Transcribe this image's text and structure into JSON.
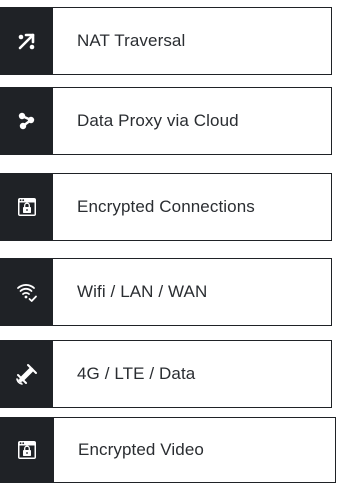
{
  "features": [
    {
      "label": "NAT Traversal",
      "icon": "nat-traversal-arrows-icon"
    },
    {
      "label": "Data Proxy via Cloud",
      "icon": "data-proxy-nodes-icon"
    },
    {
      "label": "Encrypted Connections",
      "icon": "browser-lock-icon"
    },
    {
      "label": "Wifi / LAN / WAN",
      "icon": "wifi-check-icon"
    },
    {
      "label": "4G / LTE / Data",
      "icon": "satellite-signal-icon"
    },
    {
      "label": "Encrypted Video",
      "icon": "browser-lock-icon"
    }
  ],
  "colors": {
    "icon_background": "#1f2226",
    "icon_foreground": "#ffffff",
    "text": "#2a2d31",
    "border": "#1f2226"
  }
}
